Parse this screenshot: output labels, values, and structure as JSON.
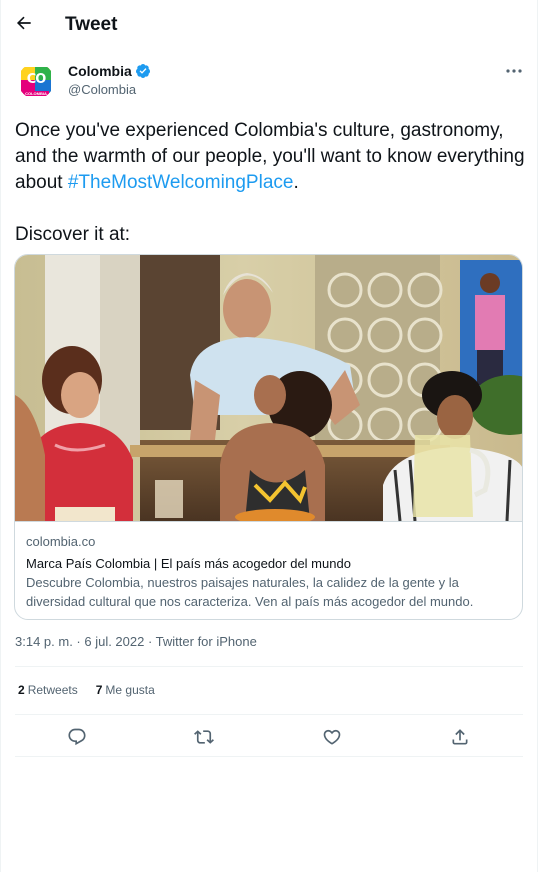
{
  "header": {
    "title": "Tweet"
  },
  "author": {
    "name": "Colombia",
    "handle": "@Colombia",
    "avatar_text": "CO",
    "avatar_subtext": "COLOMBIA"
  },
  "tweet": {
    "text_before": "Once you've experienced Colombia's culture, gastronomy, and the warmth of our people, you'll want to know everything about ",
    "hashtag": "#TheMostWelcomingPlace",
    "text_after": ".",
    "line2": "Discover it at:"
  },
  "card": {
    "domain": "colombia.co",
    "title": "Marca País Colombia | El país más acogedor del mundo",
    "description": "Descubre Colombia, nuestros paisajes naturales, la calidez de la gente y la diversidad cultural que nos caracteriza. Ven al país más acogedor del mundo."
  },
  "meta": {
    "timestamp": "3:14 p. m. · 6 jul. 2022 · Twitter for iPhone"
  },
  "stats": {
    "retweets_count": "2",
    "retweets_label": "Retweets",
    "likes_count": "7",
    "likes_label": "Me gusta"
  },
  "colors": {
    "accent": "#1d9bf0",
    "text": "#0f1419",
    "secondary": "#536471",
    "border": "#cfd9de"
  },
  "icons": [
    "back-arrow-icon",
    "verified-badge-icon",
    "more-icon",
    "reply-icon",
    "retweet-icon",
    "like-icon",
    "share-icon"
  ]
}
